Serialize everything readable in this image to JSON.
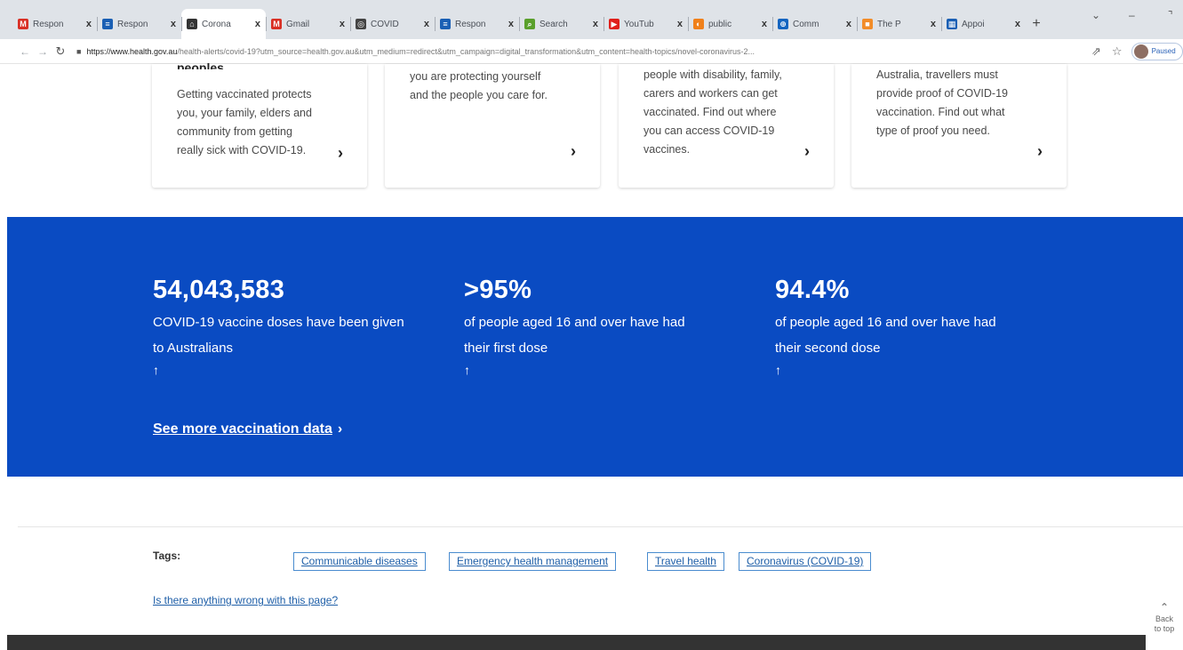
{
  "browser": {
    "tabs": [
      {
        "label": "Respon",
        "icon": "gmail-icon",
        "color": "#d93025",
        "glyph": "M",
        "active": false
      },
      {
        "label": "Respon",
        "icon": "forms-icon",
        "color": "#1a5fb4",
        "glyph": "≡",
        "active": false
      },
      {
        "label": "Corona",
        "icon": "gov-crest-icon",
        "color": "#333333",
        "glyph": "⌂",
        "active": true
      },
      {
        "label": "Gmail",
        "icon": "gmail-icon",
        "color": "#d93025",
        "glyph": "M",
        "active": false
      },
      {
        "label": "COVID",
        "icon": "globe-icon",
        "color": "#444444",
        "glyph": "◎",
        "active": false
      },
      {
        "label": "Respon",
        "icon": "forms-icon",
        "color": "#1a5fb4",
        "glyph": "≡",
        "active": false
      },
      {
        "label": "Search",
        "icon": "search-icon",
        "color": "#5aa02c",
        "glyph": "⌕",
        "active": false
      },
      {
        "label": "YouTub",
        "icon": "youtube-icon",
        "color": "#e0201b",
        "glyph": "▶",
        "active": false
      },
      {
        "label": "public",
        "icon": "public-icon",
        "color": "#f0801a",
        "glyph": "◐",
        "active": false
      },
      {
        "label": "Comm",
        "icon": "globe-icon",
        "color": "#1565c0",
        "glyph": "⊕",
        "active": false
      },
      {
        "label": "The P",
        "icon": "bookmark-icon",
        "color": "#f28c28",
        "glyph": "■",
        "active": false
      },
      {
        "label": "Appoi",
        "icon": "calendar-icon",
        "color": "#1a5fb4",
        "glyph": "▦",
        "active": false
      }
    ],
    "tab_close": "x",
    "new_tab": "+",
    "url_host": "https://www.health.gov.au",
    "url_rest": "/health-alerts/covid-19?utm_source=health.gov.au&utm_medium=redirect&utm_campaign=digital_transformation&utm_content=health-topics/novel-coronavirus-2...",
    "profile_label": "Paused"
  },
  "cards": [
    {
      "title": "peoples",
      "lines": [
        "Getting vaccinated protects",
        "you, your family, elders and",
        "community from getting",
        "really sick with COVID-19."
      ]
    },
    {
      "title": "",
      "lines": [
        "you are protecting yourself",
        "and the people you care for."
      ]
    },
    {
      "title": "",
      "lines": [
        "people with disability, family,",
        "carers and workers can get",
        "vaccinated. Find out where",
        "you can access COVID-19",
        "vaccines."
      ]
    },
    {
      "title": "",
      "lines": [
        "Australia, travellers must",
        "provide proof of COVID-19",
        "vaccination. Find out what",
        "type of proof you need."
      ]
    }
  ],
  "stats": [
    {
      "value": "54,043,583",
      "line1": "COVID-19 vaccine doses have been given",
      "line2": "to Australians"
    },
    {
      "value": ">95%",
      "line1": "of people aged 16 and over have had",
      "line2": "their first dose"
    },
    {
      "value": "94.4%",
      "line1": "of people aged 16 and over have had",
      "line2": "their second dose"
    }
  ],
  "see_more_label": "See more vaccination data",
  "tags": {
    "label": "Tags:",
    "items": [
      "Communicable diseases",
      "Emergency health management",
      "Travel health",
      "Coronavirus (COVID-19)"
    ]
  },
  "feedback_link": "Is there anything wrong with this page?",
  "back_to_top": {
    "line1": "Back",
    "line2": "to top"
  },
  "colors": {
    "band": "#0a4bc2",
    "link": "#1f5fa8",
    "tag_border": "#4a8ccf"
  }
}
